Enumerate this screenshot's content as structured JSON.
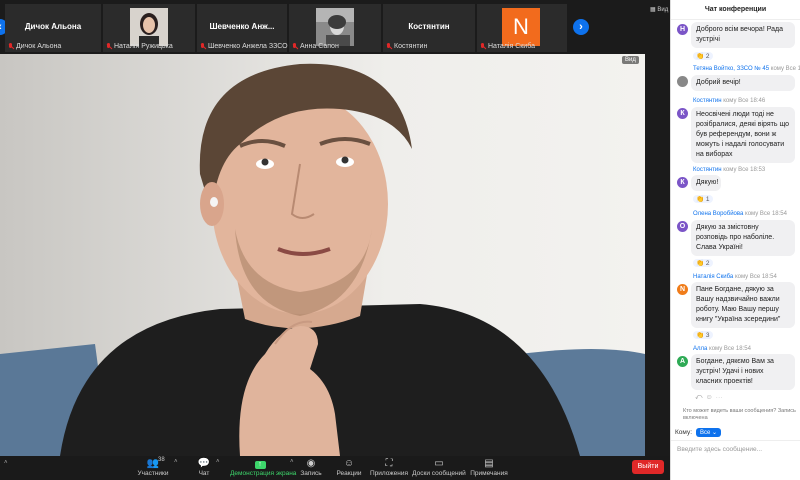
{
  "thumbnails": [
    {
      "name": "Дичок Альона",
      "label": "Дичок Альона",
      "has_photo": false
    },
    {
      "name": "",
      "label": "Наталія Ружицька",
      "has_photo": true
    },
    {
      "name": "Шевченко Анж...",
      "label": "Шевченко Анжела ЗЗСО ...",
      "has_photo": false
    },
    {
      "name": "",
      "label": "Анна Сапон",
      "has_photo": true
    },
    {
      "name": "Костянтин",
      "label": "Костянтин",
      "has_photo": false
    },
    {
      "name": "",
      "label": "Наталія Скиба",
      "has_photo": false,
      "initial": "N"
    }
  ],
  "view_label": "Вид",
  "video_view_badge": "Вид",
  "toolbar": {
    "participants_count": "38",
    "participants": "Участники",
    "chat": "Чат",
    "share": "Демонстрация экрана",
    "record": "Запись",
    "reactions": "Реакции",
    "apps": "Приложения",
    "whiteboards": "Доски сообщений",
    "notes": "Примечания",
    "leave": "Выйти"
  },
  "chat": {
    "title": "Чат конференции",
    "messages": [
      {
        "sender": "",
        "to": "",
        "time": "",
        "initial": "Н",
        "color": "#7b55c7",
        "text": "Доброго всім вечора! Рада зустрічі",
        "reaction": "👏 2"
      },
      {
        "sender": "Тетяна Войтко, ЗЗСО № 45",
        "to": "кому Все",
        "time": "1",
        "initial": "",
        "color": "#888888",
        "text": "Добрий вечір!",
        "reaction": ""
      },
      {
        "sender": "Костянтин",
        "to": "кому Все",
        "time": "18:46",
        "initial": "К",
        "color": "#7b55c7",
        "text": "Неосвічені люди тоді не розібралися, деякі вірять що був референдум, вони ж можуть і надалі голосувати на виборах",
        "reaction": ""
      },
      {
        "sender": "Костянтин",
        "to": "кому Все",
        "time": "18:53",
        "initial": "К",
        "color": "#7b55c7",
        "text": "Дякую!",
        "reaction": "👏 1"
      },
      {
        "sender": "Олена Воробйова",
        "to": "кому Все",
        "time": "18:54",
        "initial": "О",
        "color": "#7b55c7",
        "text": "Дякую за змістовну розповідь про наболіле. Слава Україні!",
        "reaction": "👏 2"
      },
      {
        "sender": "Наталія Скиба",
        "to": "кому Все",
        "time": "18:54",
        "initial": "N",
        "color": "#f07c1a",
        "text": "Пане Богдане, дякую за Вашу надзвичайно важли роботу. Маю Вашу першу книгу \"Україна зсередини\"",
        "reaction": "👏 3"
      },
      {
        "sender": "Алла",
        "to": "кому Все",
        "time": "18:54",
        "initial": "А",
        "color": "#2eaa55",
        "text": "Богдане, дякємо Вам за зустріч! Удачі і нових класних проектів!",
        "reaction": ""
      }
    ],
    "privacy_note": "Кто может видеть ваши сообщения? Запись включена",
    "to_label": "Кому:",
    "to_value": "Все",
    "input_placeholder": "Введите здесь сообщение..."
  }
}
